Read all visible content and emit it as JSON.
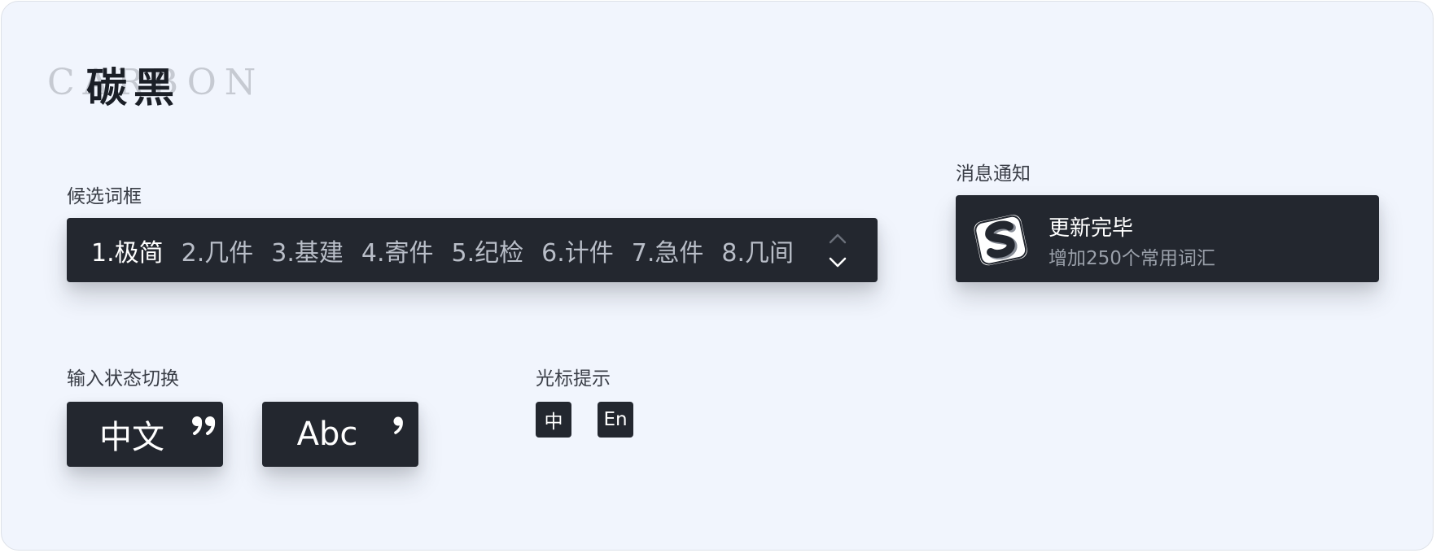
{
  "title": {
    "background_text": "CARBON",
    "foreground_text": "碳黑"
  },
  "candidate_box": {
    "label": "候选词框",
    "candidates": [
      "1.极简",
      "2.几件",
      "3.基建",
      "4.寄件",
      "5.纪检",
      "6.计件",
      "7.急件",
      "8.几间"
    ],
    "pager_up_icon": "chevron-up-icon",
    "pager_down_icon": "chevron-down-icon"
  },
  "notification": {
    "label": "消息通知",
    "logo_icon": "sogou-s-logo-icon",
    "title": "更新完毕",
    "subtitle": "增加250个常用词汇"
  },
  "input_state": {
    "label": "输入状态切换",
    "chinese": "中文",
    "english": "Abc"
  },
  "cursor_hint": {
    "label": "光标提示",
    "chinese": "中",
    "english": "En"
  },
  "colors": {
    "background": "#f1f5fd",
    "panel": "#23272f",
    "text_primary": "#ffffff",
    "text_secondary": "#b9bec8",
    "label": "#3a3e47"
  }
}
